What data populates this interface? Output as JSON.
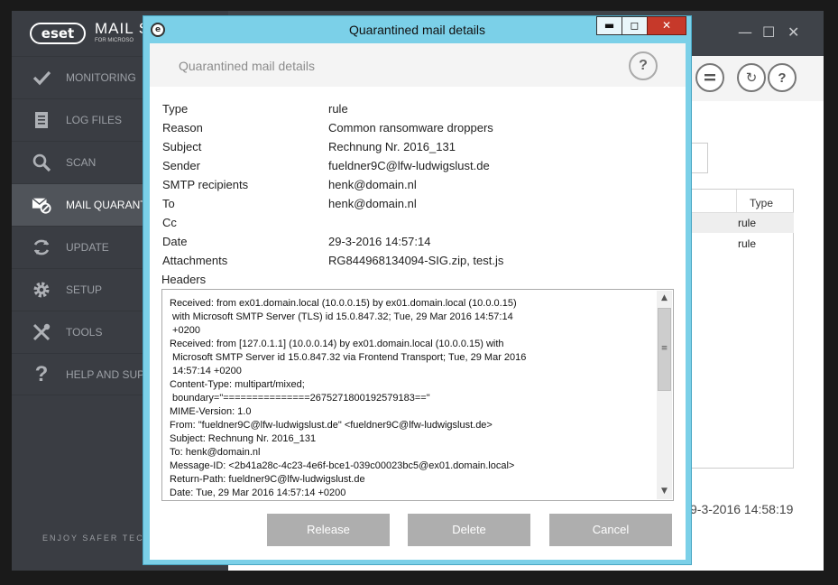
{
  "app": {
    "logo_text": "eset",
    "product_name": "MAIL S",
    "product_sub": "FOR MICROSO",
    "tagline": "ENJOY SAFER TECH"
  },
  "sidebar": {
    "items": [
      {
        "label": "MONITORING",
        "icon": "check-icon"
      },
      {
        "label": "LOG FILES",
        "icon": "log-files-icon"
      },
      {
        "label": "SCAN",
        "icon": "search-icon"
      },
      {
        "label": "MAIL QUARANT",
        "icon": "mail-quarantine-icon"
      },
      {
        "label": "UPDATE",
        "icon": "update-icon"
      },
      {
        "label": "SETUP",
        "icon": "gear-icon"
      },
      {
        "label": "TOOLS",
        "icon": "tools-icon"
      },
      {
        "label": "HELP AND SUPP",
        "icon": "help-icon"
      }
    ],
    "active_index": 3
  },
  "background": {
    "table_header_type": "Type",
    "rows": [
      "rule",
      "rule"
    ],
    "date_fragment": "9-3-2016 14:58:19"
  },
  "dialog": {
    "window_title": "Quarantined mail details",
    "header_title": "Quarantined mail details",
    "fields": [
      {
        "label": "Type",
        "value": "rule"
      },
      {
        "label": "Reason",
        "value": "Common ransomware droppers"
      },
      {
        "label": "Subject",
        "value": "Rechnung Nr. 2016_131"
      },
      {
        "label": "Sender",
        "value": "fueldner9C@lfw-ludwigslust.de"
      },
      {
        "label": "SMTP recipients",
        "value": "henk@domain.nl"
      },
      {
        "label": "To",
        "value": "henk@domain.nl"
      },
      {
        "label": "Cc",
        "value": ""
      },
      {
        "label": "Date",
        "value": "29-3-2016 14:57:14"
      },
      {
        "label": "Attachments",
        "value": "RG844968134094-SIG.zip, test.js"
      }
    ],
    "headers_label": "Headers",
    "headers_text": "Received: from ex01.domain.local (10.0.0.15) by ex01.domain.local (10.0.0.15)\n with Microsoft SMTP Server (TLS) id 15.0.847.32; Tue, 29 Mar 2016 14:57:14\n +0200\nReceived: from [127.0.1.1] (10.0.0.14) by ex01.domain.local (10.0.0.15) with\n Microsoft SMTP Server id 15.0.847.32 via Frontend Transport; Tue, 29 Mar 2016\n 14:57:14 +0200\nContent-Type: multipart/mixed;\n boundary=\"===============2675271800192579183==\"\nMIME-Version: 1.0\nFrom: \"fueldner9C@lfw-ludwigslust.de\" <fueldner9C@lfw-ludwigslust.de>\nSubject: Rechnung Nr. 2016_131\nTo: henk@domain.nl\nMessage-ID: <2b41a28c-4c23-4e6f-bce1-039c00023bc5@ex01.domain.local>\nReturn-Path: fueldner9C@lfw-ludwigslust.de\nDate: Tue, 29 Mar 2016 14:57:14 +0200",
    "buttons": {
      "release": "Release",
      "delete": "Delete",
      "cancel": "Cancel"
    },
    "help_glyph": "?",
    "colors": {
      "frame": "#7bd0e8",
      "button": "#aeaeae",
      "close": "#c6392a"
    }
  }
}
